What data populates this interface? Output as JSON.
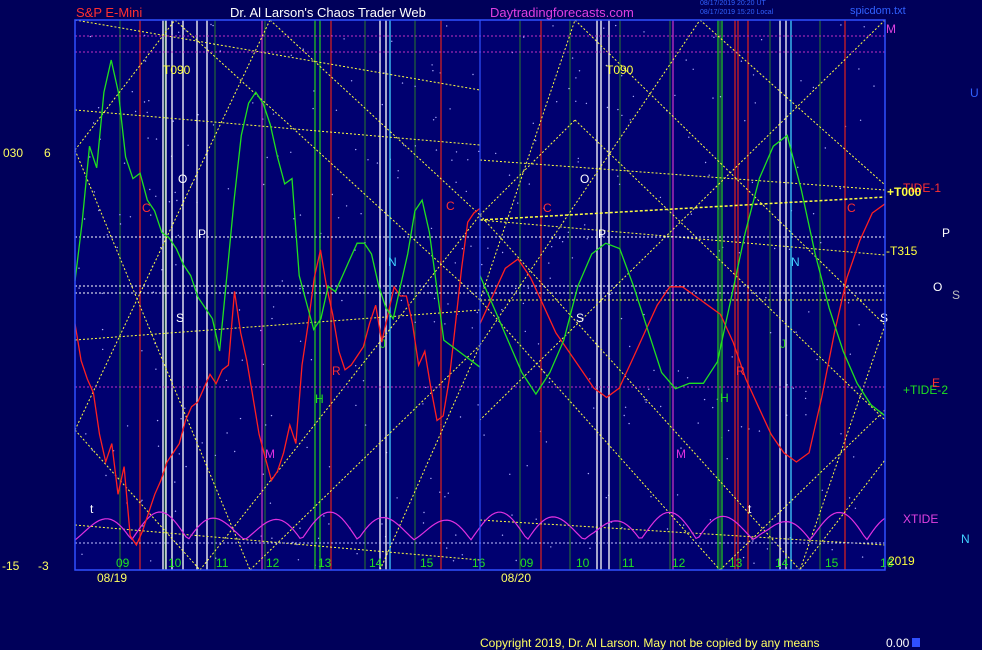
{
  "header": {
    "symbol": "S&P E-Mini",
    "author": "Dr. Al Larson's Chaos Trader Web",
    "site": "Daytradingforecasts.com",
    "timestamp_line1": "08/17/2019 20:20 UT",
    "timestamp_line2": "08/17/2019 15:20 Local",
    "file": "spicdom.txt"
  },
  "left_scale": {
    "top_a": "030",
    "top_b": "6",
    "bottom_a": "-15",
    "bottom_b": "-3"
  },
  "right_labels": {
    "m": "M",
    "u": "U",
    "tide1": "TIDE-1",
    "t000": "+T000",
    "t315": "-T315",
    "p": "P",
    "o": "O",
    "s": "S",
    "tide2": "+TIDE-2",
    "e": "E",
    "xtide": "XTIDE",
    "n": "N",
    "year": "2019"
  },
  "footer": {
    "copyright": "Copyright 2019, Dr. Al Larson. May not be copied by any means",
    "value": "0.00"
  },
  "colors": {
    "background": "#00005a",
    "plot_bg": "#000070",
    "tide1": "#ff2020",
    "tide2": "#20e020",
    "xtide": "#e030e0",
    "yellow": "#ffff40",
    "grid": "#2a7a2a",
    "red_line": "#d02020",
    "green_line": "#20c020",
    "magenta_line": "#c030c0",
    "white_line": "#ffffff",
    "cyan_line": "#40d0ff",
    "plot_border": "#3050ff"
  },
  "chart_data": {
    "type": "line",
    "title": "S&P E-Mini",
    "x_days": [
      "08/19",
      "08/20"
    ],
    "x_hour_ticks": [
      "09",
      "10",
      "11",
      "12",
      "13",
      "14",
      "15",
      "16",
      "09",
      "10",
      "11",
      "12",
      "13",
      "14",
      "15",
      "16"
    ],
    "planet_line_labels": [
      {
        "text": "T090",
        "color": "#ffff40"
      },
      {
        "text": "O",
        "color": "#ffffff"
      },
      {
        "text": "C",
        "color": "#ff3030"
      },
      {
        "text": "P",
        "color": "#ffffff"
      },
      {
        "text": "S",
        "color": "#ffffff"
      },
      {
        "text": "M",
        "color": "#e030e0"
      },
      {
        "text": "H",
        "color": "#20e020"
      },
      {
        "text": "R",
        "color": "#ff3030"
      },
      {
        "text": "J",
        "color": "#20c020"
      },
      {
        "text": "N",
        "color": "#40d0ff"
      },
      {
        "text": "C",
        "color": "#ff3030"
      },
      {
        "text": "t",
        "color": "#ffffff"
      },
      {
        "text": "T090",
        "color": "#ffff40"
      },
      {
        "text": "O",
        "color": "#ffffff"
      },
      {
        "text": "C",
        "color": "#ff3030"
      },
      {
        "text": "P",
        "color": "#ffffff"
      },
      {
        "text": "S",
        "color": "#ffffff"
      },
      {
        "text": "M",
        "color": "#e030e0"
      },
      {
        "text": "R",
        "color": "#ff3030"
      },
      {
        "text": "H",
        "color": "#20e020"
      },
      {
        "text": "J",
        "color": "#20c020"
      },
      {
        "text": "N",
        "color": "#40d0ff"
      },
      {
        "text": "C",
        "color": "#ff3030"
      },
      {
        "text": "S",
        "color": "#ffffff"
      },
      {
        "text": "t",
        "color": "#ffffff"
      }
    ],
    "series": [
      {
        "name": "TIDE-1",
        "color": "#ff2020",
        "y_range": [
          -3,
          6
        ],
        "values": [
          1.8,
          1.0,
          0.6,
          0.3,
          -0.6,
          -1.2,
          -0.8,
          -1.9,
          -1.3,
          -2.8,
          -3.0,
          -2.7,
          -2.3,
          -1.9,
          -1.6,
          -1.2,
          -1.0,
          -0.8,
          -0.3,
          0.0,
          0.1,
          0.4,
          0.7,
          0.5,
          0.8,
          0.9,
          2.5,
          1.6,
          1.0,
          0.2,
          -0.6,
          -1.1,
          -1.6,
          -1.4,
          -1.0,
          -0.4,
          -0.8,
          0.9,
          1.8,
          2.8,
          3.4,
          2.6,
          2.0,
          1.2,
          0.8,
          0.9,
          1.1,
          1.3,
          1.8,
          2.2,
          1.4,
          2.0,
          2.6,
          2.4,
          2.4,
          1.8,
          0.9,
          1.2,
          0.4,
          -0.3,
          -0.2,
          0.6,
          1.8,
          3.0,
          4.0,
          4.2,
          4.3
        ]
      },
      {
        "name": "TIDE-2",
        "color": "#20e020",
        "y_range": [
          -15,
          30
        ],
        "values": [
          9.5,
          15,
          22,
          20,
          27,
          30,
          27,
          21,
          19,
          19.5,
          17,
          16,
          14,
          13.5,
          12.5,
          11,
          10,
          8,
          7,
          6,
          3,
          10,
          17,
          23,
          26,
          27,
          26,
          24,
          21,
          18.5,
          19,
          10,
          7.5,
          5,
          6,
          9,
          8.5,
          10,
          11.5,
          13,
          13,
          12,
          9,
          7,
          6,
          9,
          12,
          16,
          17,
          14,
          9,
          4,
          3.5,
          3,
          2.5,
          2,
          1.5
        ]
      },
      {
        "name": "XTIDE",
        "color": "#e030e0",
        "y_range": [
          0,
          1
        ],
        "values": []
      }
    ]
  }
}
